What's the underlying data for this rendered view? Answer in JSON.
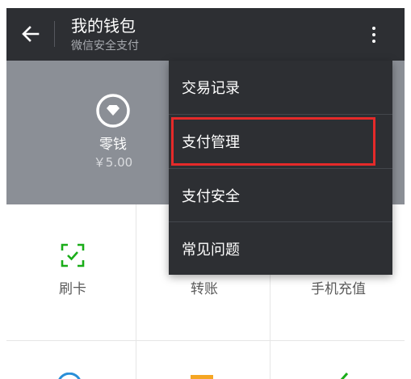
{
  "header": {
    "title": "我的钱包",
    "subtitle": "微信安全支付",
    "back_icon": "arrow-left-icon",
    "more_icon": "more-vertical-icon"
  },
  "wallet": {
    "label": "零钱",
    "value": "￥5.00",
    "icon": "diamond-circle-icon"
  },
  "grid": {
    "items": [
      {
        "label": "刷卡",
        "icon": "scan-card-icon"
      },
      {
        "label": "转账",
        "icon": "transfer-icon"
      },
      {
        "label": "手机充值",
        "icon": "phone-recharge-icon"
      }
    ]
  },
  "menu": {
    "items": [
      {
        "label": "交易记录"
      },
      {
        "label": "支付管理"
      },
      {
        "label": "支付安全"
      },
      {
        "label": "常见问题"
      }
    ],
    "highlighted_index": 1
  },
  "colors": {
    "appbar": "#2d2f33",
    "band": "#8b8f96",
    "accent_green": "#1aad19",
    "highlight_red": "#e52a2a"
  }
}
